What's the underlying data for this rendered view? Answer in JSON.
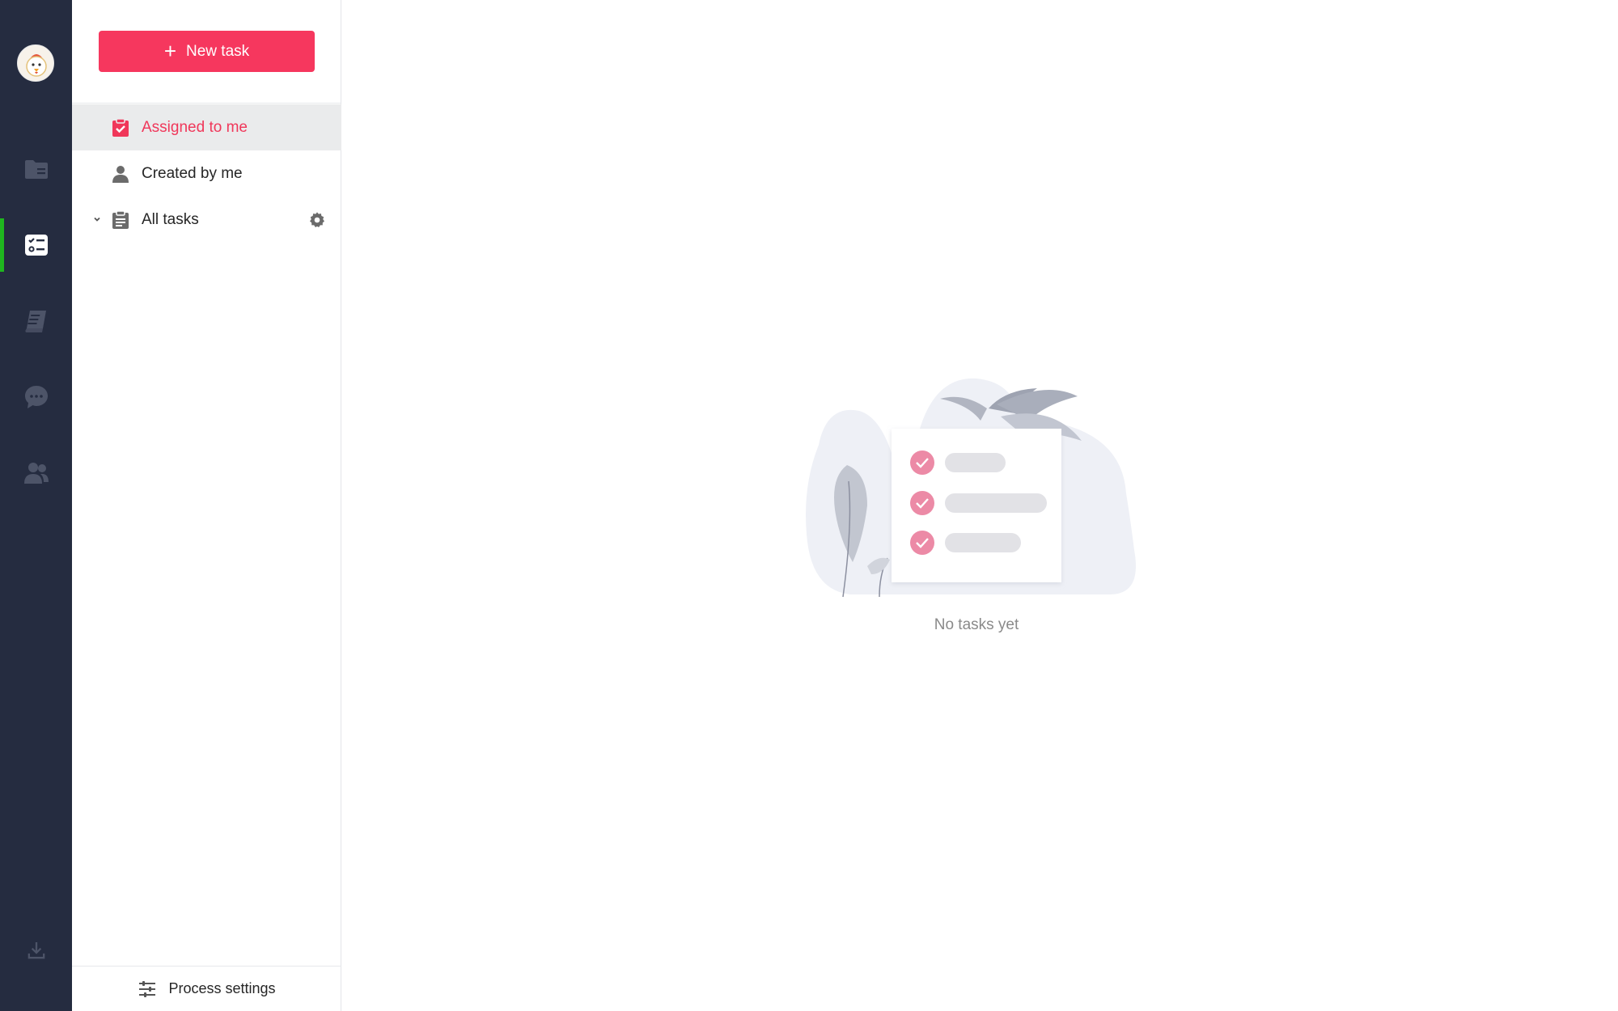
{
  "sidebar": {
    "new_task_label": "New task",
    "items": [
      {
        "label": "Assigned to me",
        "icon": "clipboard-check-icon",
        "active": true
      },
      {
        "label": "Created by me",
        "icon": "user-icon",
        "active": false
      },
      {
        "label": "All tasks",
        "icon": "clipboard-list-icon",
        "active": false
      }
    ],
    "process_settings_label": "Process settings"
  },
  "rail": {
    "items": [
      "folder-icon",
      "tasks-icon",
      "book-icon",
      "chat-icon",
      "team-icon"
    ],
    "active": "tasks-icon",
    "bottom": "download-icon"
  },
  "main": {
    "empty_text": "No tasks yet"
  },
  "colors": {
    "accent": "#f6375e",
    "rail_bg": "#252c40",
    "rail_active_indicator": "#1fb61f",
    "check_pink": "#ec8aa6"
  }
}
